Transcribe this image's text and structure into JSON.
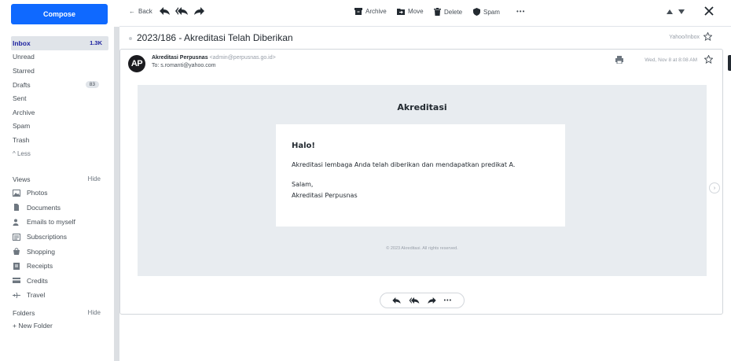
{
  "sidebar": {
    "compose_label": "Compose",
    "items": [
      {
        "label": "Inbox",
        "count": "1.3K"
      },
      {
        "label": "Unread"
      },
      {
        "label": "Starred"
      },
      {
        "label": "Drafts",
        "count": "83"
      },
      {
        "label": "Sent"
      },
      {
        "label": "Archive"
      },
      {
        "label": "Spam"
      },
      {
        "label": "Trash"
      },
      {
        "label": "^ Less"
      }
    ],
    "views_label": "Views",
    "views_hide": "Hide",
    "views": [
      {
        "label": "Photos",
        "icon": "photo-icon"
      },
      {
        "label": "Documents",
        "icon": "document-icon"
      },
      {
        "label": "Emails to myself",
        "icon": "person-icon"
      },
      {
        "label": "Subscriptions",
        "icon": "subscriptions-icon"
      },
      {
        "label": "Shopping",
        "icon": "shopping-icon"
      },
      {
        "label": "Receipts",
        "icon": "receipt-icon"
      },
      {
        "label": "Credits",
        "icon": "credit-card-icon"
      },
      {
        "label": "Travel",
        "icon": "plane-icon"
      }
    ],
    "folders_label": "Folders",
    "folders_hide": "Hide",
    "new_folder": "+ New Folder"
  },
  "toolbar": {
    "back": "Back",
    "archive": "Archive",
    "move": "Move",
    "delete": "Delete",
    "spam": "Spam",
    "more": "•••"
  },
  "message": {
    "subject": "2023/186 - Akreditasi Telah Diberikan",
    "folder_path": "Yahoo/Inbox",
    "avatar_initials": "AP",
    "sender_name": "Akreditasi Perpusnas",
    "sender_email": "<admin@perpusnas.go.id>",
    "to": "To: s.romanti@yahoo.com",
    "date": "Wed, Nov 8 at 8:08 AM"
  },
  "email_body": {
    "title": "Akreditasi",
    "greeting": "Halo!",
    "line1": "Akreditasi lembaga Anda telah diberikan dan mendapatkan predikat A.",
    "salam": "Salam,",
    "signature": "Akreditasi Perpusnas",
    "footer": "© 2023 Akreditasi. All rights reserved."
  },
  "actions": {
    "more": "•••"
  },
  "colors": {
    "accent": "#0f69ff",
    "active_bg": "#e0e4e9",
    "mail_bg": "#e8ecf0"
  }
}
